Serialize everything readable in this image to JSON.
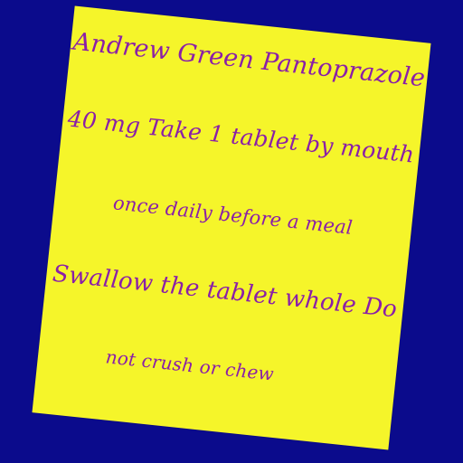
{
  "note": {
    "lines": [
      "Andrew Green Pantoprazole",
      "40 mg Take 1 tablet by mouth",
      "once daily before a meal",
      "Swallow the tablet whole Do",
      "not crush or chew"
    ]
  },
  "colors": {
    "background": "#0b0b8c",
    "paper": "#f5f52a",
    "ink": "#8a1fa8"
  }
}
